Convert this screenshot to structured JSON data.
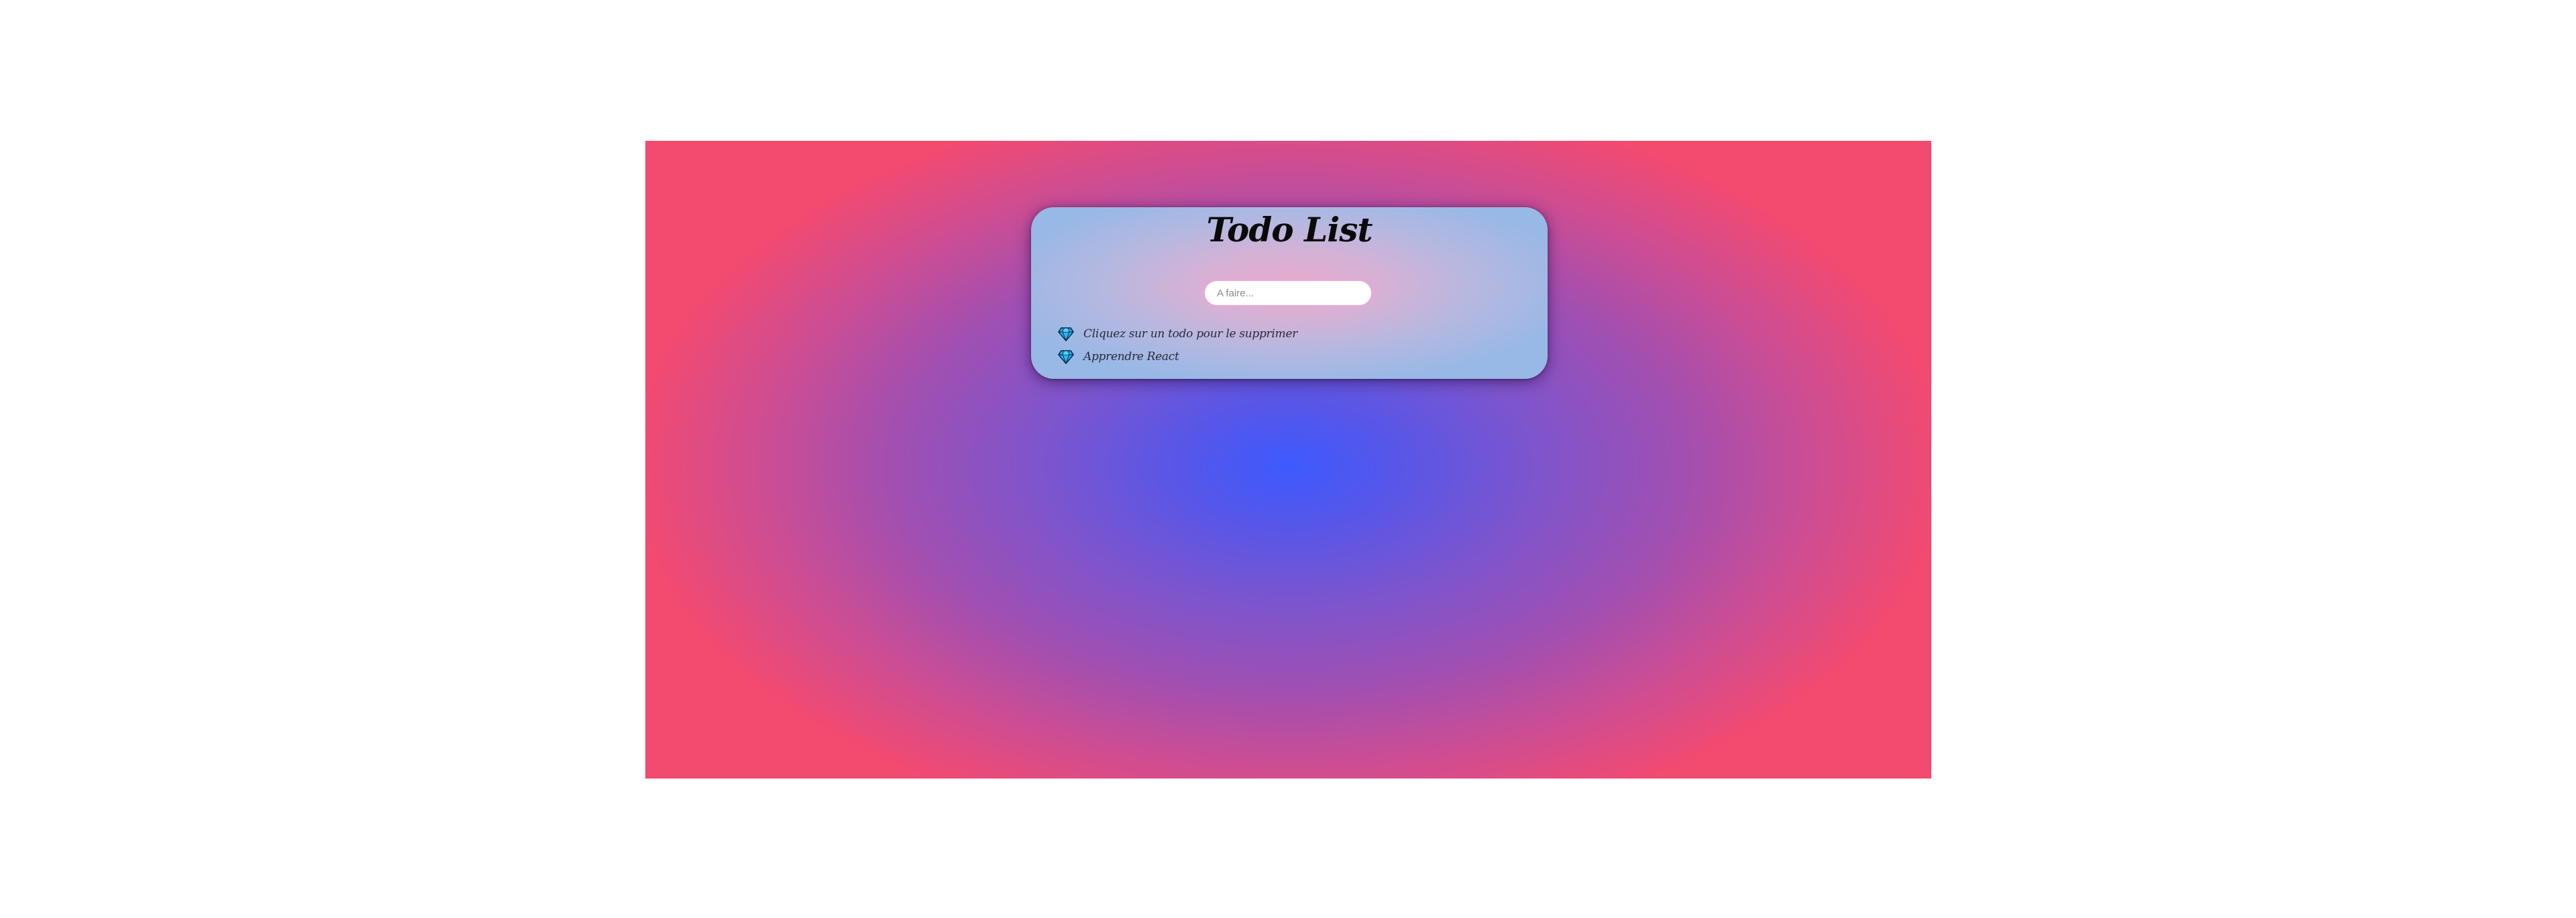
{
  "app": {
    "title": "Todo List"
  },
  "input": {
    "placeholder": "A faire...",
    "value": ""
  },
  "todos": [
    {
      "label": "Cliquez sur un todo pour le supprimer",
      "icon": "gem-icon"
    },
    {
      "label": "Apprendre React",
      "icon": "gem-icon"
    }
  ],
  "colors": {
    "background_center": "#3d5afe",
    "background_edge": "#f34a70",
    "card_center": "#e8a9cc",
    "card_edge": "#98b8e6",
    "input_border": "#e5a9d6",
    "gem_fill": "#29b6f6"
  }
}
